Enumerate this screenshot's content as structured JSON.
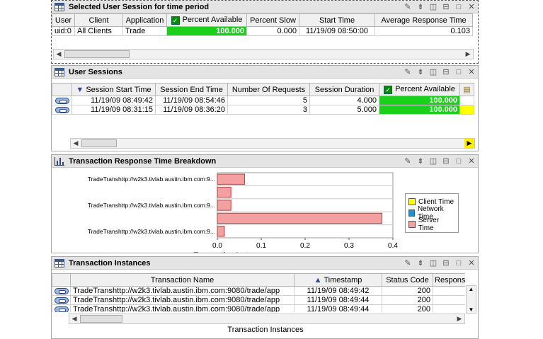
{
  "panels": {
    "selected": {
      "title": "Selected User Session for time period",
      "columns": [
        "User",
        "Client",
        "Application",
        "Percent Available",
        "Percent Slow",
        "Start Time",
        "Average Response Time"
      ],
      "row": [
        "uid:0",
        "All Clients",
        "Trade",
        "100.000",
        "0.000",
        "11/19/09 08:50:00",
        "0.103"
      ]
    },
    "sessions": {
      "title": "User Sessions",
      "columns": [
        "Session Start Time",
        "Session End Time",
        "Number Of Requests",
        "Session Duration",
        "Percent Available"
      ],
      "rows": [
        [
          "11/19/09 08:49:42",
          "11/19/09 08:54:46",
          "5",
          "4.000",
          "100.000"
        ],
        [
          "11/19/09 08:31:15",
          "11/19/09 08:36:20",
          "3",
          "5.000",
          "100.000"
        ]
      ]
    },
    "breakdown": {
      "title": "Transaction Response Time Breakdown"
    },
    "instances": {
      "title": "Transaction Instances",
      "columns": [
        "Transaction Name",
        "Timestamp",
        "Status Code",
        "Respons"
      ],
      "rows": [
        [
          "TradeTranshttp://w2k3.tivlab.austin.ibm.com:9080/trade/app",
          "11/19/09 08:49:42",
          "200",
          ""
        ],
        [
          "TradeTranshttp://w2k3.tivlab.austin.ibm.com:9080/trade/app",
          "11/19/09 08:49:44",
          "200",
          ""
        ],
        [
          "TradeTranshttp://w2k3.tivlab.austin.ibm.com:9080/trade/app",
          "11/19/09 08:49:44",
          "200",
          ""
        ]
      ],
      "footer": "Transaction Instances"
    }
  },
  "toolbar_icons": [
    "pencil-icon",
    "collapse-icon",
    "split-vertical-icon",
    "split-horizontal-icon",
    "maximize-icon",
    "close-icon"
  ],
  "chart_data": {
    "type": "bar",
    "orientation": "horizontal",
    "categories": [
      "TradeTranshttp://w2k3.tivlab.austin.ibm.com:9...",
      "TradeTranshttp://w2k3.tivlab.austin.ibm.com:9...",
      "TradeTranshttp://w2k3.tivlab.austin.ibm.com:9..."
    ],
    "series": [
      {
        "name": "Client Time",
        "color": "#ffff00",
        "values": [
          0,
          0,
          0,
          0,
          0
        ]
      },
      {
        "name": "Network Time",
        "color": "#1e90d6",
        "values": [
          0,
          0,
          0,
          0,
          0
        ]
      },
      {
        "name": "Server Time",
        "color": "#f4a0a0",
        "values": [
          0.062,
          0.031,
          0.031,
          0.375,
          0.016
        ]
      }
    ],
    "xlabel": "Transaction Instances",
    "xticks": [
      "0.0",
      "0.1",
      "0.2",
      "0.3",
      "0.4"
    ],
    "xlim": [
      0,
      0.4
    ],
    "grid": true,
    "legend_position": "right"
  },
  "colors": {
    "available_green": "#1bd01b",
    "highlight_yellow": "#ffff00"
  }
}
